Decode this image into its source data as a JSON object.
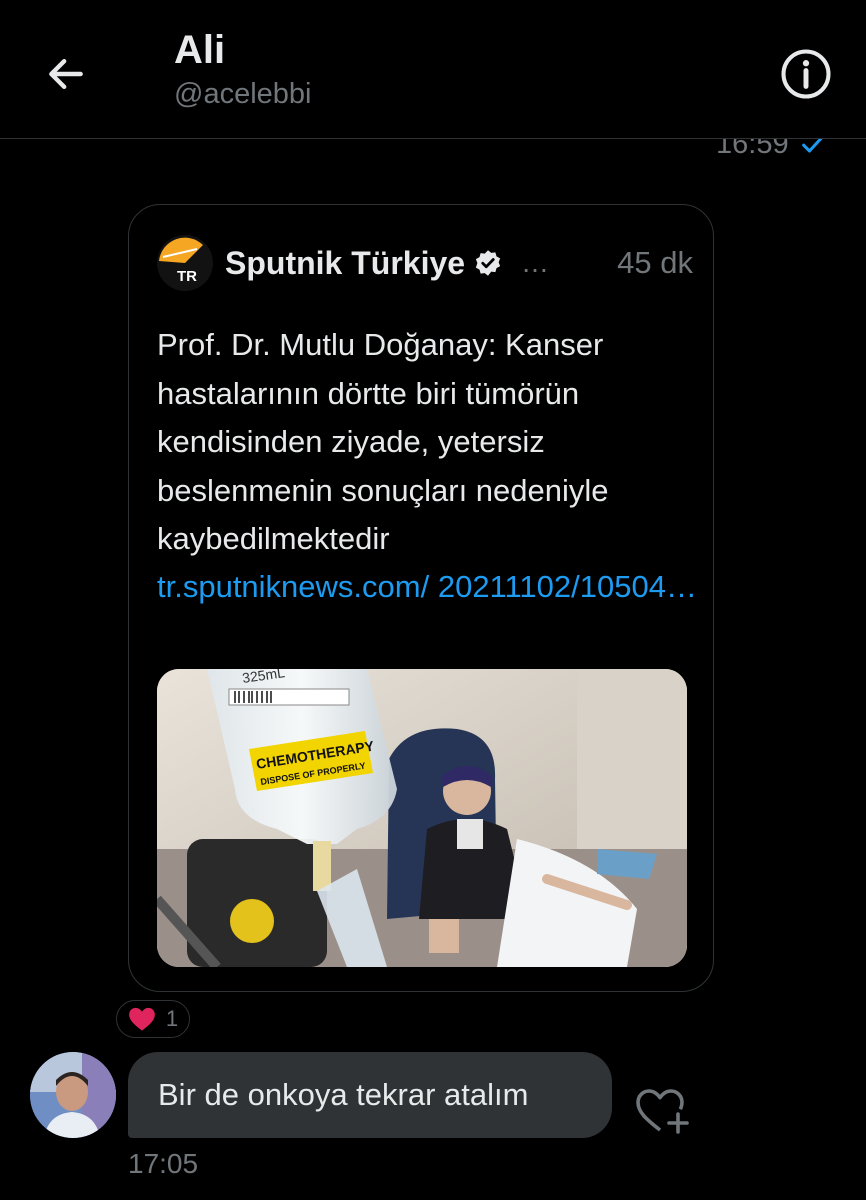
{
  "header": {
    "title": "Ali",
    "handle": "@acelebbi"
  },
  "sent_message": {
    "time": "16:59"
  },
  "quoted_tweet": {
    "source_name": "Sputnik Türkiye",
    "source_badge": "TR",
    "more": "…",
    "age": "45 dk",
    "text": "Prof. Dr. Mutlu Doğanay: Kanser hastalarının dörtte biri tümörün kendisinden ziyade, yetersiz beslenmenin sonuçları nedeniyle kaybedilmektedir",
    "link": "tr.sputniknews.com/ 20211102/10504…",
    "media": {
      "bag_volume": "325mL",
      "bag_label_1": "CHEMOTHERAPY",
      "bag_label_2": "DISPOSE OF PROPERLY"
    }
  },
  "reaction": {
    "emoji": "heart-icon",
    "count": "1"
  },
  "received_message": {
    "text": "Bir de onkoya tekrar atalım",
    "time": "17:05"
  },
  "colors": {
    "background": "#000000",
    "accent": "#1d9bf0",
    "bubble": "#2f3336",
    "muted": "#71767b",
    "heart": "#f91880"
  }
}
